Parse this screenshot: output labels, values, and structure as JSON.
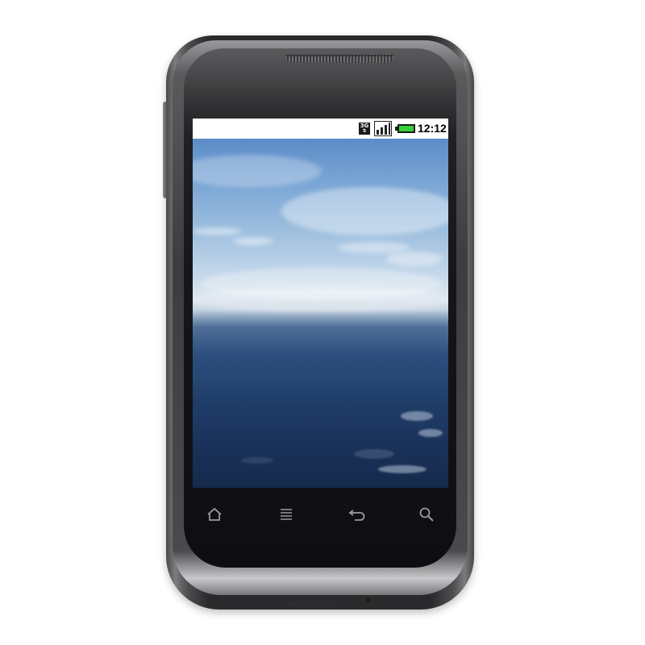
{
  "status_bar": {
    "network_label": "3G",
    "signal_icon": "signal-bars-icon",
    "battery_icon": "battery-full-icon",
    "battery_color": "#38d038",
    "time": "12:12"
  },
  "wallpaper": {
    "description_icon": "ocean-horizon-wallpaper",
    "sky_color": "#78a4d4",
    "sea_color": "#203e6a"
  },
  "nav_keys": [
    {
      "name": "home",
      "icon": "home-icon"
    },
    {
      "name": "menu",
      "icon": "menu-icon"
    },
    {
      "name": "back",
      "icon": "back-icon"
    },
    {
      "name": "search",
      "icon": "search-icon"
    }
  ],
  "device": {
    "body_color": "#2a2a2c",
    "trim_color": "#7c7c7e"
  }
}
